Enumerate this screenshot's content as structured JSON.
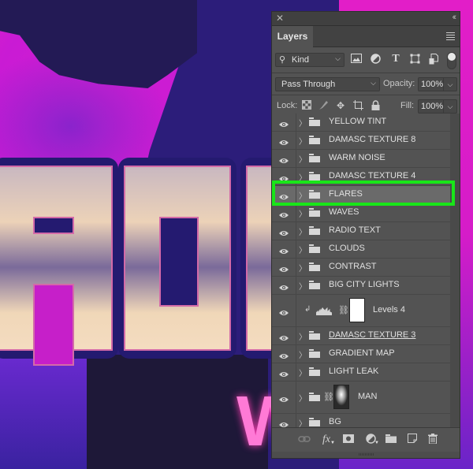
{
  "panel": {
    "title_tab": "Layers",
    "filter": {
      "kind_label": "Kind",
      "icons": [
        "image-filter-icon",
        "adjustment-filter-icon",
        "type-filter-icon",
        "shape-filter-icon",
        "smart-object-filter-icon"
      ]
    },
    "blend_mode": "Pass Through",
    "opacity_label": "Opacity:",
    "opacity_value": "100%",
    "lock_label": "Lock:",
    "fill_label": "Fill:",
    "fill_value": "100%",
    "layers": [
      {
        "name": "YELLOW TINT",
        "type": "group",
        "visible": true
      },
      {
        "name": "DAMASC TEXTURE 8",
        "type": "group",
        "visible": true
      },
      {
        "name": "WARM NOISE",
        "type": "group",
        "visible": true
      },
      {
        "name": "DAMASC TEXTURE 4",
        "type": "group",
        "visible": true
      },
      {
        "name": "FLARES",
        "type": "group",
        "visible": true,
        "selected": true
      },
      {
        "name": "WAVES",
        "type": "group",
        "visible": true
      },
      {
        "name": "RADIO TEXT",
        "type": "group",
        "visible": true
      },
      {
        "name": "CLOUDS",
        "type": "group",
        "visible": true
      },
      {
        "name": "CONTRAST",
        "type": "group",
        "visible": true
      },
      {
        "name": "BIG CITY LIGHTS",
        "type": "group",
        "visible": true
      },
      {
        "name": "Levels 4",
        "type": "adjustment",
        "visible": true,
        "clipped": true
      },
      {
        "name": "DAMASC TEXTURE 3",
        "type": "group",
        "visible": true,
        "underlined": true
      },
      {
        "name": "GRADIENT MAP",
        "type": "group",
        "visible": true
      },
      {
        "name": "LIGHT LEAK",
        "type": "group",
        "visible": true
      },
      {
        "name": "MAN",
        "type": "group-masked",
        "visible": true
      },
      {
        "name": "BG",
        "type": "group",
        "visible": true
      }
    ],
    "footer_icons": [
      "link-layers-icon",
      "fx-icon",
      "add-mask-icon",
      "new-adjustment-icon",
      "new-group-icon",
      "new-layer-icon",
      "delete-layer-icon"
    ],
    "fx_label": "fx"
  },
  "highlight_color": "#19e619",
  "artwork": {
    "neon_letter": "W"
  }
}
